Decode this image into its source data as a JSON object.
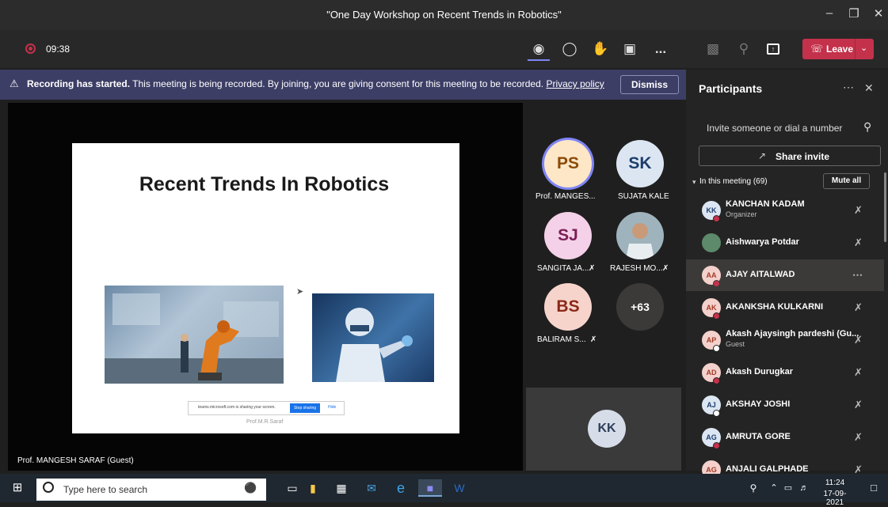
{
  "window": {
    "title": "\"One Day Workshop on Recent Trends in Robotics\""
  },
  "toolbar": {
    "timer": "09:38",
    "leave_label": "Leave",
    "more_label": "...",
    "colors": {
      "leave": "#c4314b",
      "record": "#c4314b"
    }
  },
  "banner": {
    "bold": "Recording has started.",
    "text": "This meeting is being recorded. By joining, you are giving consent for this meeting to be recorded.",
    "link": "Privacy policy",
    "dismiss": "Dismiss"
  },
  "stage": {
    "slide_title": "Recent Trends In Robotics",
    "share_text": "teams.microsoft.com is sharing your screen.",
    "stop_sharing": "Stop sharing",
    "hide": "Hide",
    "slide_footer": "Prof.M.R.Saraf",
    "presenter_name": "Prof. MANGESH SARAF (Guest)"
  },
  "gallery": {
    "tiles": [
      {
        "initials": "PS",
        "label": "Prof. MANGES...",
        "bg": "#fde7c7",
        "fg": "#8a4b08"
      },
      {
        "initials": "SK",
        "label": "SUJATA KALE",
        "bg": "#dce6f2",
        "fg": "#1c3e6e"
      },
      {
        "initials": "SJ",
        "label": "SANGITA JA...",
        "bg": "#f4d1e8",
        "fg": "#7a1e56"
      },
      {
        "initials": "",
        "label": "RAJESH MO...",
        "bg": "#8aa0a8",
        "fg": "#fff"
      },
      {
        "initials": "BS",
        "label": "BALIRAM S...",
        "bg": "#f6d4cc",
        "fg": "#8a2a17"
      },
      {
        "initials": "+63",
        "label": "",
        "bg": "#3b3a39",
        "fg": "#fff"
      }
    ],
    "self_tile": {
      "initials": "KK",
      "bg": "#d6dde8",
      "fg": "#2d3e5a"
    }
  },
  "panel": {
    "title": "Participants",
    "invite_placeholder": "Invite someone or dial a number",
    "share_invite": "Share invite",
    "section": "In this meeting (69)",
    "mute_all": "Mute all",
    "participants": [
      {
        "initials": "KK",
        "name": "KANCHAN KADAM",
        "sub": "Organizer"
      },
      {
        "initials": "",
        "name": "Aishwarya Potdar",
        "sub": ""
      },
      {
        "initials": "AA",
        "name": "AJAY AITALWAD",
        "sub": ""
      },
      {
        "initials": "AK",
        "name": "AKANKSHA KULKARNI",
        "sub": ""
      },
      {
        "initials": "AP",
        "name": "Akash Ajaysingh pardeshi (Gu...",
        "sub": "Guest"
      },
      {
        "initials": "AD",
        "name": "Akash Durugkar",
        "sub": ""
      },
      {
        "initials": "AJ",
        "name": "AKSHAY JOSHI",
        "sub": ""
      },
      {
        "initials": "AG",
        "name": "AMRUTA GORE",
        "sub": ""
      },
      {
        "initials": "AG",
        "name": "ANJALI GALPHADE",
        "sub": ""
      }
    ]
  },
  "taskbar": {
    "search_placeholder": "Type here to search",
    "time": "11:24",
    "date": "17-09-2021"
  }
}
